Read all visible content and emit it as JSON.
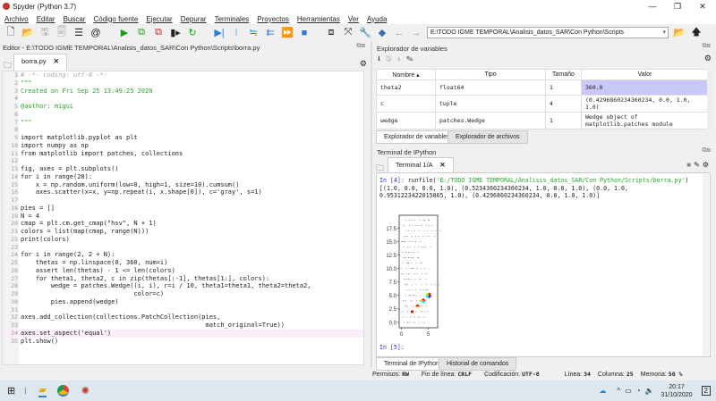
{
  "window": {
    "title": "Spyder (Python 3.7)",
    "minimize": "—",
    "maximize": "❐",
    "close": "✕"
  },
  "menu": [
    "Archivo",
    "Editar",
    "Buscar",
    "Código fuente",
    "Ejecutar",
    "Depurar",
    "Terminales",
    "Proyectos",
    "Herramientas",
    "Ver",
    "Ayuda"
  ],
  "toolbar": {
    "path": "E:\\TODO IGME TEMPORAL\\Analisis_datos_SAR\\Con Python\\Scripts"
  },
  "editor": {
    "header": "Editor - E:\\TODO IGME TEMPORAL\\Analisis_datos_SAR\\Con Python\\Scripts\\borra.py",
    "tab": "borra.py",
    "current_line": 34,
    "lines": [
      "# -*- coding: utf-8 -*-",
      "\"\"\"",
      "Created on Fri Sep 25 13:49:25 2020",
      "",
      "@author: migui",
      "",
      "\"\"\"",
      "",
      "import matplotlib.pyplot as plt",
      "import numpy as np",
      "from matplotlib import patches, collections",
      "",
      "fig, axes = plt.subplots()",
      "for i in range(20):",
      "    x = np.random.uniform(low=0, high=1, size=10).cumsum()",
      "    axes.scatter(x=x, y=np.repeat(i, x.shape[0]), c='gray', s=1)",
      "",
      "pies = []",
      "N = 4",
      "cmap = plt.cm.get_cmap(\"hsv\", N + 1)",
      "colors = list(map(cmap, range(N)))",
      "print(colors)",
      "",
      "for i in range(2, 2 + N):",
      "    thetas = np.linspace(0, 360, num=i)",
      "    assert len(thetas) - 1 <= len(colors)",
      "    for theta1, theta2, c in zip(thetas[:-1], thetas[1:], colors):",
      "        wedge = patches.Wedge((i, i), r=i / 10, theta1=theta1, theta2=theta2,",
      "                              color=c)",
      "        pies.append(wedge)",
      "",
      "axes.add_collection(collections.PatchCollection(pies,",
      "                                                 match_original=True))",
      "axes.set_aspect('equal')",
      "plt.show()"
    ]
  },
  "variables": {
    "title": "Explorador de variables",
    "columns": [
      "Nombre",
      "Tipo",
      "Tamaño",
      "Valor"
    ],
    "rows": [
      {
        "name": "theta2",
        "type": "float64",
        "size": "1",
        "value": "360.0"
      },
      {
        "name": "c",
        "type": "tuple",
        "size": "4",
        "value": "(0.4296860234360234, 0.0, 1.0, 1.0)"
      },
      {
        "name": "wedge",
        "type": "patches.Wedge",
        "size": "1",
        "value": "Wedge object of matplotlib.patches module"
      }
    ],
    "tabs": [
      "Explorador de variables",
      "Explorador de archivos"
    ]
  },
  "terminal": {
    "title": "Terminal de IPython",
    "tab": "Terminal 1/A",
    "in4_prompt": "In [4]: ",
    "in4_cmd": "runfile(",
    "in4_arg": "'E:/TODO IGME TEMPORAL/Analisis_datos_SAR/Con Python/Scripts/borra.py'",
    "in4_close": ")",
    "output": "[(1.0, 0.0, 0.0, 1.0), (0.5234360234360234, 1.0, 0.0, 1.0), (0.0, 1.0, 0.9531223422015865, 1.0), (0.4296860234360234, 0.0, 1.0, 1.0)]",
    "in5_prompt": "In [5]:",
    "tabs": [
      "Terminal de IPython",
      "Historial de comandos"
    ]
  },
  "chart_data": {
    "type": "scatter",
    "xlim": [
      -0.4,
      6.7
    ],
    "ylim": [
      -1,
      19.9
    ],
    "xticks": [
      "0",
      "5"
    ],
    "yticks": [
      "0.0",
      "2.5",
      "5.0",
      "7.5",
      "10.0",
      "12.5",
      "15.0",
      "17.5"
    ],
    "scatter_rows": 20,
    "points_per_row": 10,
    "point_color": "#808080",
    "wedges": [
      {
        "center": 2,
        "r": 0.2,
        "colors": [
          "#ff0000"
        ]
      },
      {
        "center": 3,
        "r": 0.3,
        "colors": [
          "#ff0000",
          "#85ff00"
        ]
      },
      {
        "center": 4,
        "r": 0.4,
        "colors": [
          "#ff0000",
          "#85ff00",
          "#00fff3"
        ]
      },
      {
        "center": 5,
        "r": 0.5,
        "colors": [
          "#ff0000",
          "#85ff00",
          "#00fff3",
          "#6d00ff"
        ]
      }
    ]
  },
  "status": {
    "perm_label": "Permisos:",
    "perm": "RW",
    "eol_label": "Fin de línea:",
    "eol": "CRLF",
    "enc_label": "Codificación:",
    "enc": "UTF-8",
    "line_label": "Línea:",
    "line": "34",
    "col_label": "Columna:",
    "col": "25",
    "mem_label": "Memoria:",
    "mem": "50 %"
  },
  "taskbar": {
    "time": "20:17",
    "date": "31/10/2020",
    "notif_count": "2"
  }
}
